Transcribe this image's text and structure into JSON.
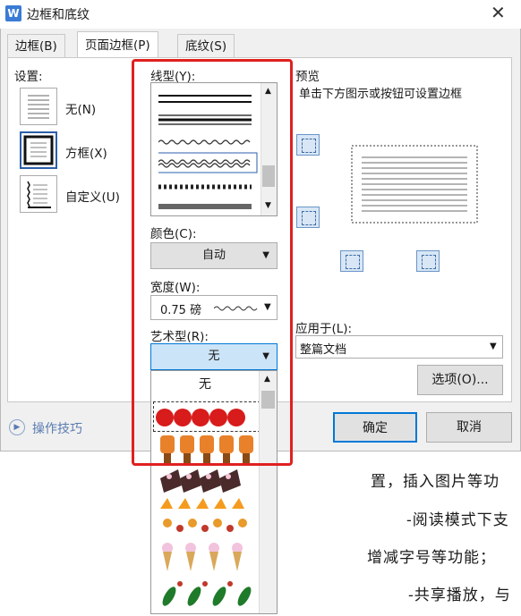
{
  "dialog": {
    "title": "边框和底纹",
    "app_icon": "W",
    "close_glyph": "✕",
    "tabs": [
      {
        "label": "边框(B)"
      },
      {
        "label": "页面边框(P)"
      },
      {
        "label": "底纹(S)"
      }
    ],
    "settings": {
      "heading": "设置:",
      "items": [
        {
          "label": "无(N)"
        },
        {
          "label": "方框(X)"
        },
        {
          "label": "自定义(U)"
        }
      ]
    },
    "line_style_label": "线型(Y):",
    "color_label": "颜色(C):",
    "color_value": "自动",
    "width_label": "宽度(W):",
    "width_value": "0.75 磅",
    "art_label": "艺术型(R):",
    "art_value": "无",
    "art_list_first": "无",
    "preview": {
      "heading": "预览",
      "hint": "单击下方图示或按钮可设置边框"
    },
    "apply_label": "应用于(L):",
    "apply_value": "整篇文档",
    "options_button": "选项(O)...",
    "tips_link": "操作技巧",
    "ok_button": "确定",
    "cancel_button": "取消"
  },
  "document": {
    "lines": [
      "置，插入图片等功",
      "-阅读模式下支",
      "增减字号等功能；",
      "-共享播放，与"
    ]
  },
  "colors": {
    "highlight_red": "#e02020",
    "selected_blue": "#cce4f7"
  }
}
